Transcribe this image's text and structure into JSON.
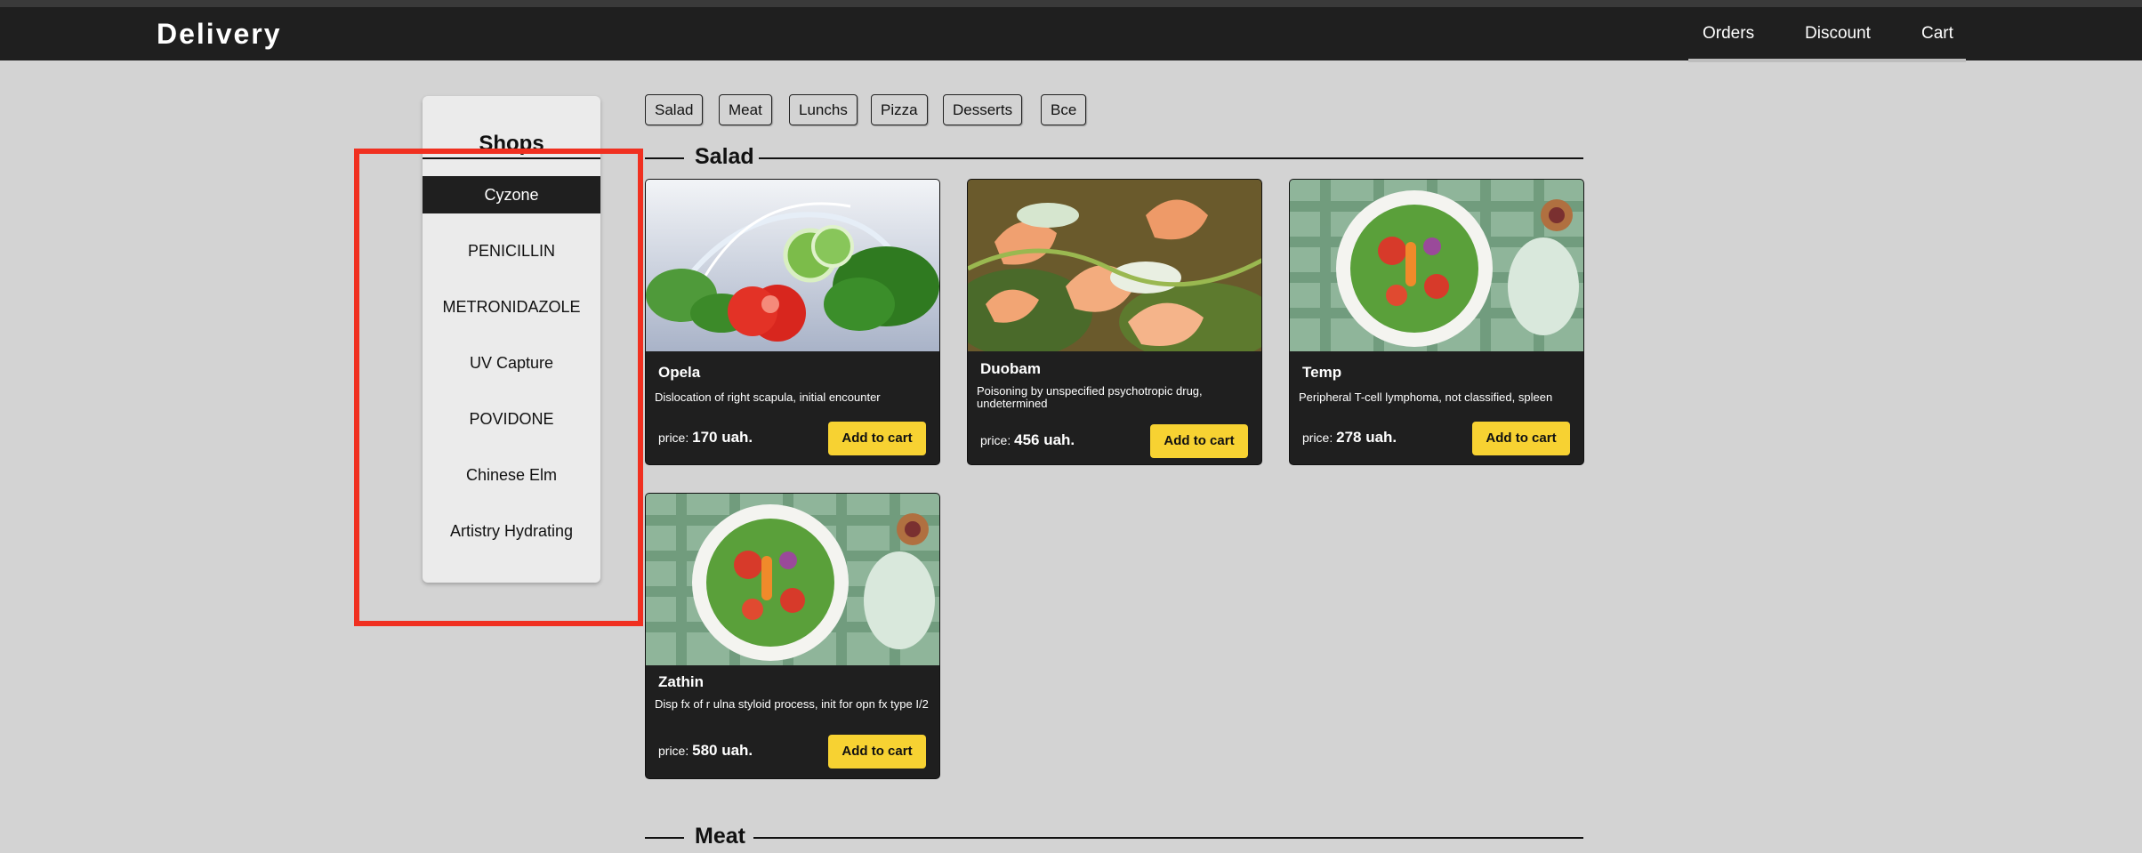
{
  "header": {
    "logo": "Delivery",
    "nav": [
      "Orders",
      "Discount",
      "Cart"
    ]
  },
  "shops": {
    "title": "Shops",
    "items": [
      "Cyzone",
      "PENICILLIN",
      "METRONIDAZOLE",
      "UV Capture",
      "POVIDONE",
      "Chinese Elm",
      "Artistry Hydrating"
    ],
    "selected": "Cyzone"
  },
  "categories": [
    "Salad",
    "Meat",
    "Lunchs",
    "Pizza",
    "Desserts",
    "Все"
  ],
  "sections": [
    "Salad",
    "Meat"
  ],
  "products": [
    {
      "name": "Opela",
      "description": "Dislocation of right scapula, initial encounter",
      "price_label": "price:",
      "price": "170 uah.",
      "button": "Add to cart"
    },
    {
      "name": "Duobam",
      "description": "Poisoning by unspecified psychotropic drug, undetermined",
      "price_label": "price:",
      "price": "456 uah.",
      "button": "Add to cart"
    },
    {
      "name": "Temp",
      "description": "Peripheral T-cell lymphoma, not classified, spleen",
      "price_label": "price:",
      "price": "278 uah.",
      "button": "Add to cart"
    },
    {
      "name": "Zathin",
      "description": "Disp fx of r ulna styloid process, init for opn fx type I/2",
      "price_label": "price:",
      "price": "580 uah.",
      "button": "Add to cart"
    }
  ],
  "colors": {
    "header_bg": "#1f1f1f",
    "page_bg": "#d3d3d3",
    "button_yellow": "#f7d232",
    "highlight_red": "#f03020"
  }
}
